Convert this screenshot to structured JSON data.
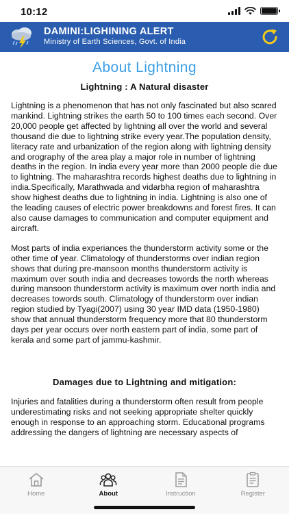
{
  "status": {
    "time": "10:12"
  },
  "header": {
    "title": "DAMINI:LIGHINING ALERT",
    "subtitle": "Ministry of Earth Sciences, Govt. of India",
    "accent": "#2a5db0",
    "refresh_color": "#f2c91e"
  },
  "content": {
    "page_title": "About Lightning",
    "heading_1": "Lightning : A Natural disaster",
    "para_1": "Lightning is a phenomenon that has not only fascinated but also scared mankind. Lightning strikes the earth 50 to 100 times each second. Over 20,000 people get affected by lightning all over the world and several thousand die due to lightning strike every year.The population density, literacy rate and urbanization of the region along with lightning density and orography of the area play a major role in number of lightning deaths in the region. In india every year more than 2000 people die due to lightning. The maharashtra records highest deaths due to lightning in india.Specifically, Marathwada and vidarbha region of maharashtra show highest deaths due to lightning in india. Lightning is also one of the leading causes of electric power breakdowns and forest fires. It can also cause damages to communication and computer equipment and aircraft.",
    "para_2": "Most parts of india experiances the thunderstorm activity some or the other time of year. Climatology of thunderstorms over indian region shows that during pre-mansoon months thunderstorm activity is maximum over south india and decreases towords the north whereas during mansoon thunderstorm activity is maximum over north india and decreases towords south. Climatology of thunderstorm over indian region studied by Tyagi(2007) using 30 year IMD data (1950-1980) show that annual thunderstorm frequency more that 80 thunderstorm days per year occurs over north eastern part of india, some part of kerala and some part of jammu-kashmir.",
    "heading_2": "Damages due to Lightning and mitigation:",
    "para_3": "Injuries and fatalities during a thunderstorm often result from people underestimating risks and not seeking appropriate shelter quickly enough in response to an approaching storm. Educational programs addressing the dangers of lightning are necessary aspects of"
  },
  "tabs": [
    {
      "label": "Home",
      "icon": "home-icon",
      "active": false
    },
    {
      "label": "About",
      "icon": "users-icon",
      "active": true
    },
    {
      "label": "Instruction",
      "icon": "document-icon",
      "active": false
    },
    {
      "label": "Register",
      "icon": "clipboard-icon",
      "active": false
    }
  ]
}
